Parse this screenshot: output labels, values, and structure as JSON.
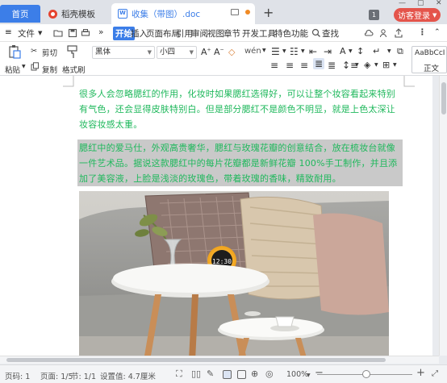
{
  "titlebar": {
    "tabs": [
      {
        "label": "首页"
      },
      {
        "label": "稻壳模板"
      },
      {
        "label": "收集（带图）.doc"
      }
    ],
    "new_tab_symbol": "+",
    "tab_count": "1",
    "guest_login": "访客登录"
  },
  "menubar": {
    "file": "文件",
    "more": "»",
    "items": [
      "开始",
      "插入",
      "页面布局",
      "引用",
      "审阅",
      "视图",
      "章节",
      "开发工具",
      "特色功能"
    ],
    "search": "查找"
  },
  "ribbon": {
    "paste": "粘贴",
    "cut": "剪切",
    "copy": "复制",
    "format_painter": "格式刷",
    "font_name": "黑体",
    "font_size": "小四",
    "style_sample": "AaBbCcI",
    "style_name": "正文"
  },
  "document": {
    "para1": "很多人会忽略腮红的作用，化妆时如果腮红选得好，可以让整个妆容看起来特别有气色，还会显得皮肤特别白。但是部分腮红不是颜色不明显，就是上色太深让妆容妆感太重。",
    "para2": "腮红中的爱马仕，外观高贵奢华，腮红与玫瑰花瓣的创意结合，放在梳妆台就像一件艺术品。据说这款腮红中的每片花瓣都是新鲜花瓣 100%手工制作，并且添加了美容液，上脸是浅淡的玫瑰色，带着玫瑰的香味，精致耐用。",
    "clock_time": "12:30",
    "text_color": "#1fb85c",
    "highlight_color": "#c9c9c9"
  },
  "statusbar": {
    "page_num": "页码: 1",
    "page": "页面: 1/5",
    "section": "节: 1/1",
    "setting": "设置值: 4.7厘米",
    "zoom": "100%",
    "zoom_fraction": 0.52
  }
}
